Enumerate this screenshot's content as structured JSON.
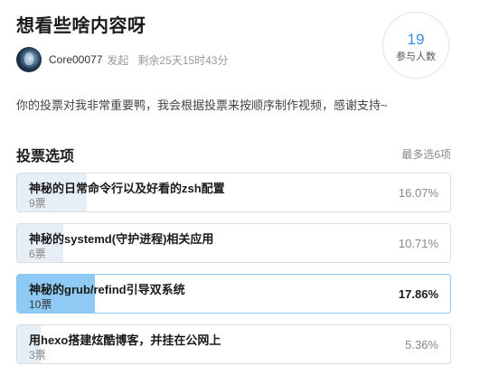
{
  "poll": {
    "title": "想看些啥内容呀",
    "author": "Core00077",
    "initiated": "发起",
    "remaining": "剩余25天15时43分",
    "participants_count": "19",
    "participants_label": "参与人数",
    "description": "你的投票对我非常重要鸭，我会根据投票来按顺序制作视频，感谢支持~"
  },
  "section": {
    "title": "投票选项",
    "max_choice": "最多选6项"
  },
  "options": [
    {
      "label": "神秘的日常命令行以及好看的zsh配置",
      "votes": "9票",
      "percent": "16.07%",
      "share": 0.1607,
      "selected": false
    },
    {
      "label": "神秘的systemd(守护进程)相关应用",
      "votes": "6票",
      "percent": "10.71%",
      "share": 0.1071,
      "selected": false
    },
    {
      "label": "神秘的grub/refind引导双系统",
      "votes": "10票",
      "percent": "17.86%",
      "share": 0.1786,
      "selected": true
    },
    {
      "label": "用hexo搭建炫酷博客，并挂在公网上",
      "votes": "3票",
      "percent": "5.36%",
      "share": 0.0536,
      "selected": false
    }
  ],
  "colors": {
    "accent": "#3a8ee6",
    "selected_fill": "#8fcaf5",
    "unselected_fill": "#e6eef6"
  }
}
